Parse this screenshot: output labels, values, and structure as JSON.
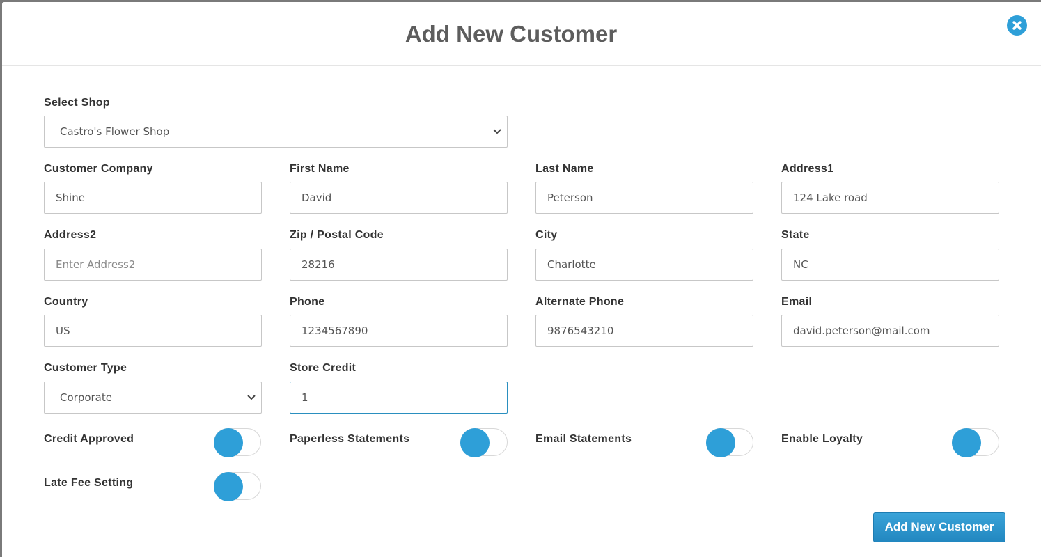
{
  "modal": {
    "title": "Add New Customer"
  },
  "form": {
    "select_shop": {
      "label": "Select Shop",
      "value": "Castro's Flower Shop"
    },
    "customer_company": {
      "label": "Customer Company",
      "value": "Shine",
      "placeholder": ""
    },
    "first_name": {
      "label": "First Name",
      "value": "David",
      "placeholder": ""
    },
    "last_name": {
      "label": "Last Name",
      "value": "Peterson",
      "placeholder": ""
    },
    "address1": {
      "label": "Address1",
      "value": "124 Lake road",
      "placeholder": ""
    },
    "address2": {
      "label": "Address2",
      "value": "",
      "placeholder": "Enter Address2"
    },
    "zip": {
      "label": "Zip / Postal Code",
      "value": "28216",
      "placeholder": ""
    },
    "city": {
      "label": "City",
      "value": "Charlotte",
      "placeholder": ""
    },
    "state": {
      "label": "State",
      "value": "NC",
      "placeholder": ""
    },
    "country": {
      "label": "Country",
      "value": "US",
      "placeholder": ""
    },
    "phone": {
      "label": "Phone",
      "value": "1234567890",
      "placeholder": ""
    },
    "alternate_phone": {
      "label": "Alternate Phone",
      "value": "9876543210",
      "placeholder": ""
    },
    "email": {
      "label": "Email",
      "value": "david.peterson@mail.com",
      "placeholder": ""
    },
    "customer_type": {
      "label": "Customer Type",
      "value": "Corporate"
    },
    "store_credit": {
      "label": "Store Credit",
      "value": "1",
      "placeholder": ""
    }
  },
  "toggles": {
    "credit_approved": {
      "label": "Credit Approved",
      "on": false
    },
    "paperless_statements": {
      "label": "Paperless Statements",
      "on": false
    },
    "email_statements": {
      "label": "Email Statements",
      "on": false
    },
    "enable_loyalty": {
      "label": "Enable Loyalty",
      "on": false
    },
    "late_fee_setting": {
      "label": "Late Fee Setting",
      "on": false
    }
  },
  "actions": {
    "submit_label": "Add New Customer"
  },
  "icons": {
    "close": "close-icon",
    "select_arrow": "chevron-down-icon"
  },
  "colors": {
    "accent": "#2e9fd8",
    "title": "#5d5d5d",
    "focus_border": "#2a8fbf"
  }
}
